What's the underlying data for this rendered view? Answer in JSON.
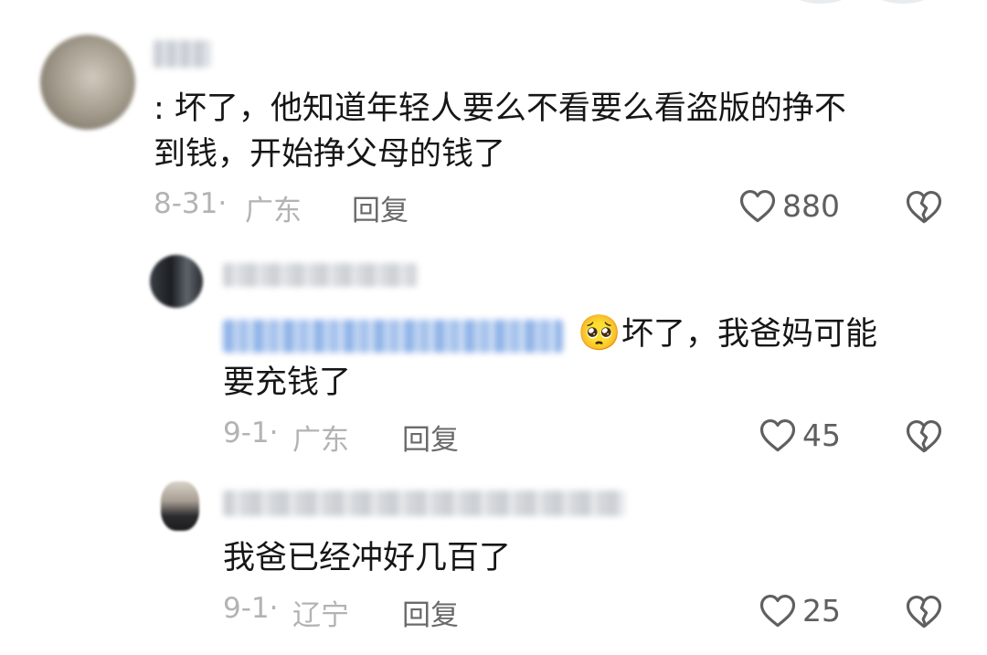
{
  "comments": [
    {
      "text_line1": ": 坏了，他知道年轻人要么不看要么看盗版的挣不",
      "text_line2": "到钱，开始挣父母的钱了",
      "date": "8-31·",
      "location": "广东",
      "reply_label": "回复",
      "likes": "880"
    }
  ],
  "replies": [
    {
      "emoji": "🥺",
      "text_line1": "坏了，我爸妈可能",
      "text_line2": "要充钱了",
      "date": "9-1·",
      "location": "广东",
      "reply_label": "回复",
      "likes": "45"
    },
    {
      "text_line1": "我爸已经冲好几百了",
      "date": "9-1·",
      "location": "辽宁",
      "reply_label": "回复",
      "likes": "25"
    }
  ],
  "icons": {
    "like": "heart-outline-icon",
    "dislike": "broken-heart-outline-icon"
  },
  "colors": {
    "text": "#161616",
    "meta": "#b3b3b3",
    "reply": "#6a6a6a",
    "icon": "#5f5f5f"
  }
}
